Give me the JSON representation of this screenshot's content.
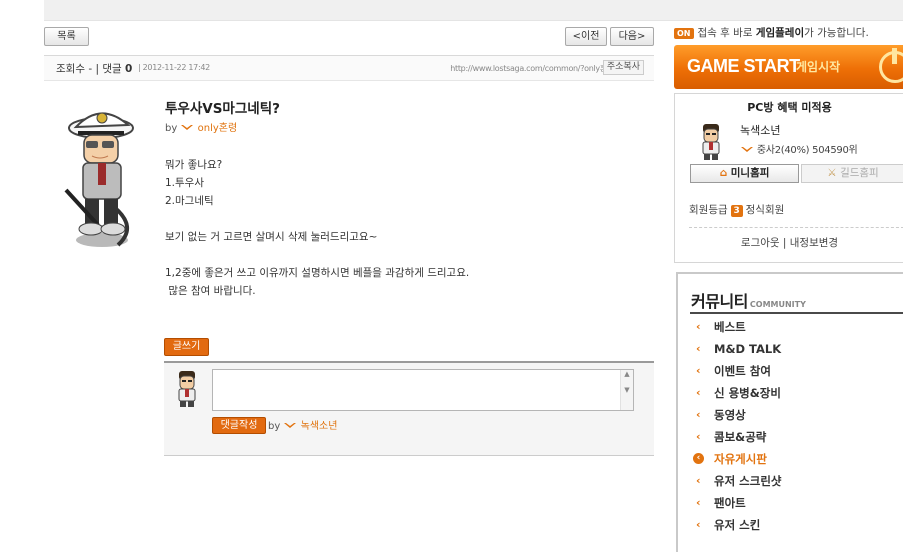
{
  "nav": {
    "list_label": "목록",
    "prev_label": "<이전",
    "next_label": "다음>"
  },
  "meta": {
    "views_label": "조회수 - | 댓글",
    "comment_count": "0",
    "date": "| 2012-11-22 17:42",
    "url": "http://www.lostsaga.com/common/?only혼령",
    "copy_label": "주소복사"
  },
  "post": {
    "title": "투우사VS마그네틱?",
    "by_label": "by",
    "author": "only혼령",
    "body": "뭐가 좋나요?\n1.투우사\n2.마그네틱\n\n보기 없는 거 고르면 살며시 삭제 눌러드리고요~\n\n1,2중에 좋은거 쓰고 이유까지 설명하시면 베플을 과감하게 드리고요.\n 많은 참여 바랍니다."
  },
  "comment": {
    "write_label": "글쓰기",
    "submit_label": "댓글작성",
    "by_label": "by",
    "author": "녹색소년"
  },
  "sidebar": {
    "notice_badge": "ON",
    "notice_pre": "접속 후 바로 ",
    "notice_bold": "게임플레이",
    "notice_post": "가 가능합니다.",
    "gamestart_label": "GAME START",
    "gamestart_sub": "게임시작",
    "pc_title": "PC방 혜택 미적용",
    "user_name": "녹색소년",
    "user_rank": "중사2(40%) 504590위",
    "minihome_label": "미니홈피",
    "guildhome_label": "길드홈피",
    "grade_label": "회원등급",
    "grade_num": "3",
    "grade_name": "정식회원",
    "links": "로그아웃 | 내정보변경"
  },
  "community": {
    "title": "커뮤니티",
    "title_en": "COMMUNITY",
    "items": [
      {
        "label": "베스트"
      },
      {
        "label": "M&D TALK"
      },
      {
        "label": "이벤트 참여"
      },
      {
        "label": "신 용병&장비"
      },
      {
        "label": "동영상"
      },
      {
        "label": "콤보&공략"
      },
      {
        "label": "자유게시판"
      },
      {
        "label": "유저 스크린샷"
      },
      {
        "label": "팬아트"
      },
      {
        "label": "유저 스킨"
      }
    ],
    "active_index": 6
  },
  "colors": {
    "accent": "#e2730f",
    "nick": "#e0730e"
  },
  "icons": [
    "wing-icon",
    "home-icon",
    "sword-icon",
    "power-icon",
    "chevron-left-icon"
  ]
}
